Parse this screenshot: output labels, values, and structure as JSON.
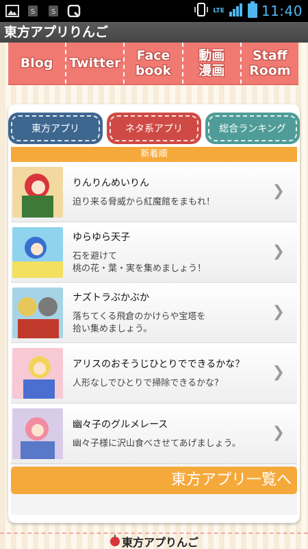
{
  "status_bar": {
    "time": "11:40",
    "network": "LTE",
    "icons": [
      "image-icon",
      "s-icon",
      "s-icon",
      "q-icon",
      "phone-vibrate-icon",
      "signal-icon",
      "battery-icon"
    ]
  },
  "app_title": "東方アプリりんご",
  "nav": [
    "Blog",
    "Twitter",
    "Face\nbook",
    "動画\n漫画",
    "Staff\nRoom"
  ],
  "tabs": [
    "東方アプリ",
    "ネタ系アプリ",
    "総合ランキング"
  ],
  "section_header": "新着順",
  "apps": [
    {
      "title": "りんりんめいりん",
      "desc": "迫り来る脅威から紅魔館をまもれ！",
      "thumb_colors": [
        "#f3d9a0",
        "#d8353c",
        "#3d7a3a"
      ]
    },
    {
      "title": "ゆらゆら天子",
      "desc": "石を避けて\n桃の花・葉・実を集めましょう！",
      "thumb_colors": [
        "#8fd3ef",
        "#3a6fd0",
        "#f2e060"
      ]
    },
    {
      "title": "ナズトラぶかぶか",
      "desc": "落ちてくる飛倉のかけらや宝塔を\n拾い集めましょう。",
      "thumb_colors": [
        "#a6d3e6",
        "#e6c85a",
        "#7a7a7a"
      ]
    },
    {
      "title": "アリスのおそうじひとりでできるかな？",
      "desc": "人形なしでひとりで掃除できるかな?",
      "thumb_colors": [
        "#f6c9d4",
        "#f2d45a",
        "#4a6fd0"
      ]
    },
    {
      "title": "幽々子のグルメレース",
      "desc": "幽々子様に沢山食べさせてあげましょう。",
      "thumb_colors": [
        "#d9cce8",
        "#f08da0",
        "#5a78c8"
      ]
    }
  ],
  "all_apps_button": "東方アプリ一覧へ",
  "footer_logo": "東方アプりんご",
  "colors": {
    "nav_bg": "#f07a72",
    "tab_blue": "#3e6790",
    "tab_red": "#cf4a44",
    "tab_teal": "#4f9c98",
    "orange": "#f6a93b"
  }
}
